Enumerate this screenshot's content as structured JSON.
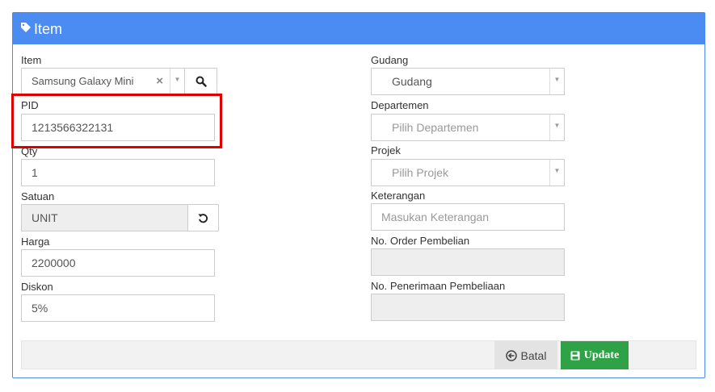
{
  "panel": {
    "title": "Item"
  },
  "left": {
    "item_label": "Item",
    "item_value": "Samsung Galaxy Mini",
    "item_clear": "×",
    "pid_label": "PID",
    "pid_value": "1213566322131",
    "qty_label": "Qty",
    "qty_value": "1",
    "satuan_label": "Satuan",
    "satuan_value": "UNIT",
    "harga_label": "Harga",
    "harga_value": "2200000",
    "diskon_label": "Diskon",
    "diskon_value": "5%"
  },
  "right": {
    "gudang_label": "Gudang",
    "gudang_value": "Gudang",
    "departemen_label": "Departemen",
    "departemen_placeholder": "Pilih Departemen",
    "projek_label": "Projek",
    "projek_placeholder": "Pilih Projek",
    "keterangan_label": "Keterangan",
    "keterangan_placeholder": "Masukan Keterangan",
    "order_label": "No. Order Pembelian",
    "order_value": "",
    "penerimaan_label": "No. Penerimaan Pembeliaan",
    "penerimaan_value": ""
  },
  "footer": {
    "batal_label": "Batal",
    "update_label": "Update"
  },
  "colors": {
    "header": "#4b8cf2",
    "update": "#2fa147",
    "highlight": "#e00000"
  },
  "icons": {
    "header": "tag-icon",
    "search": "search-icon",
    "refresh": "refresh-icon",
    "batal": "arrow-circle-left-icon",
    "update": "save-icon"
  }
}
